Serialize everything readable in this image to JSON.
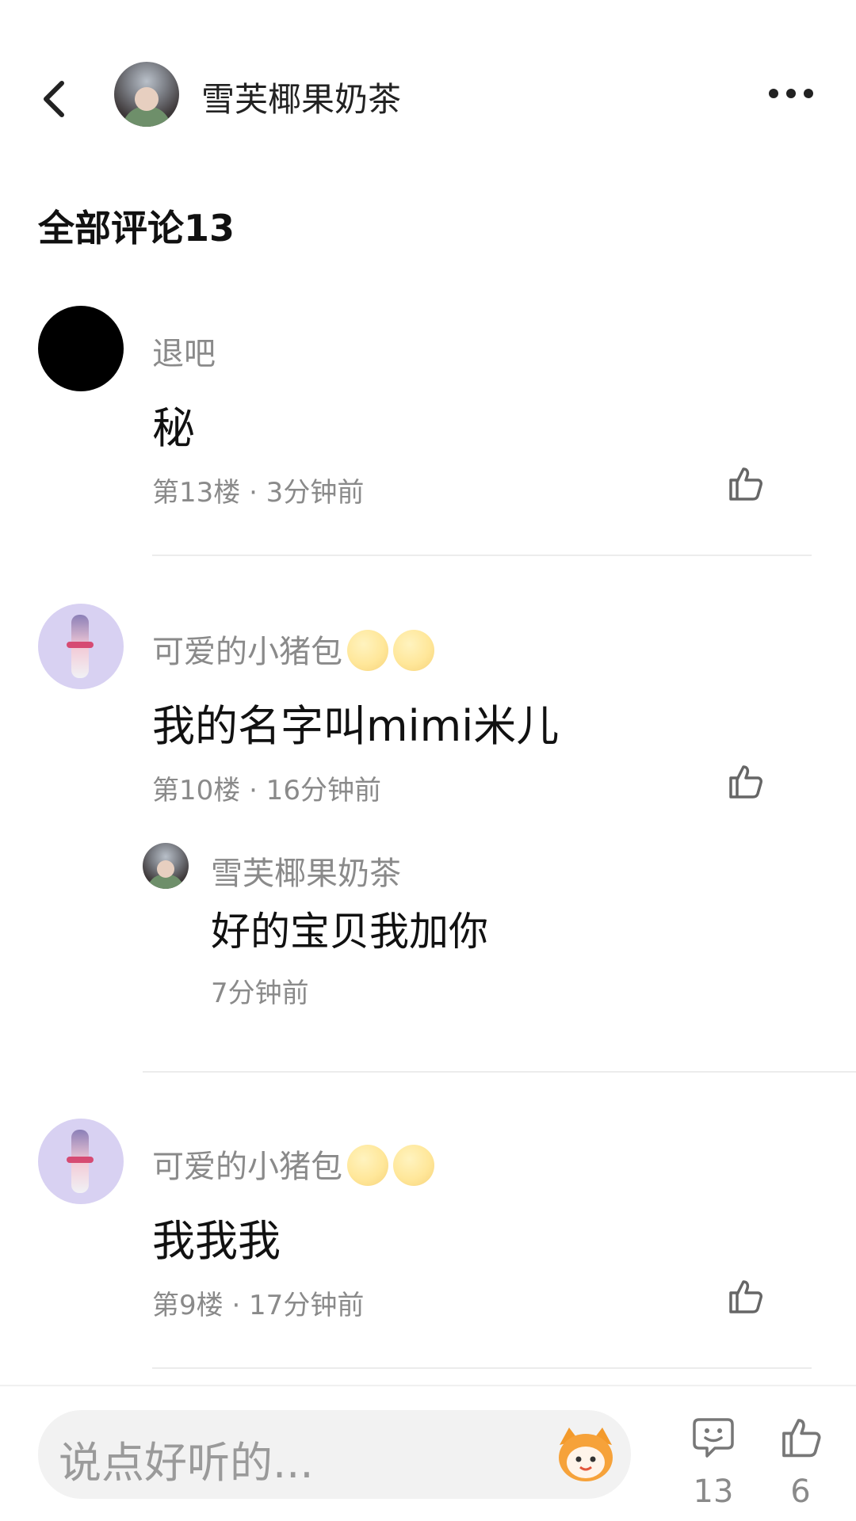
{
  "header": {
    "title": "雪芙椰果奶茶"
  },
  "section_title": "全部评论13",
  "comments": [
    {
      "username": "退吧",
      "content": "秘",
      "meta": "第13楼 · 3分钟前"
    },
    {
      "username": "可爱的小猪包",
      "content": "我的名字叫mimi米儿",
      "meta": "第10楼 · 16分钟前",
      "reply": {
        "username": "雪芙椰果奶茶",
        "content": "好的宝贝我加你",
        "meta": "7分钟前"
      }
    },
    {
      "username": "可爱的小猪包",
      "content": "我我我",
      "meta": "第9楼 · 17分钟前"
    }
  ],
  "bottom_bar": {
    "input_placeholder": "说点好听的...",
    "comment_count": "13",
    "like_count": "6"
  },
  "icons": {
    "back": "chevron-left-icon",
    "more": "more-horizontal-icon",
    "like": "thumbs-up-icon",
    "comment": "comment-bubble-icon",
    "emoji": "kissing-face-emoji"
  }
}
